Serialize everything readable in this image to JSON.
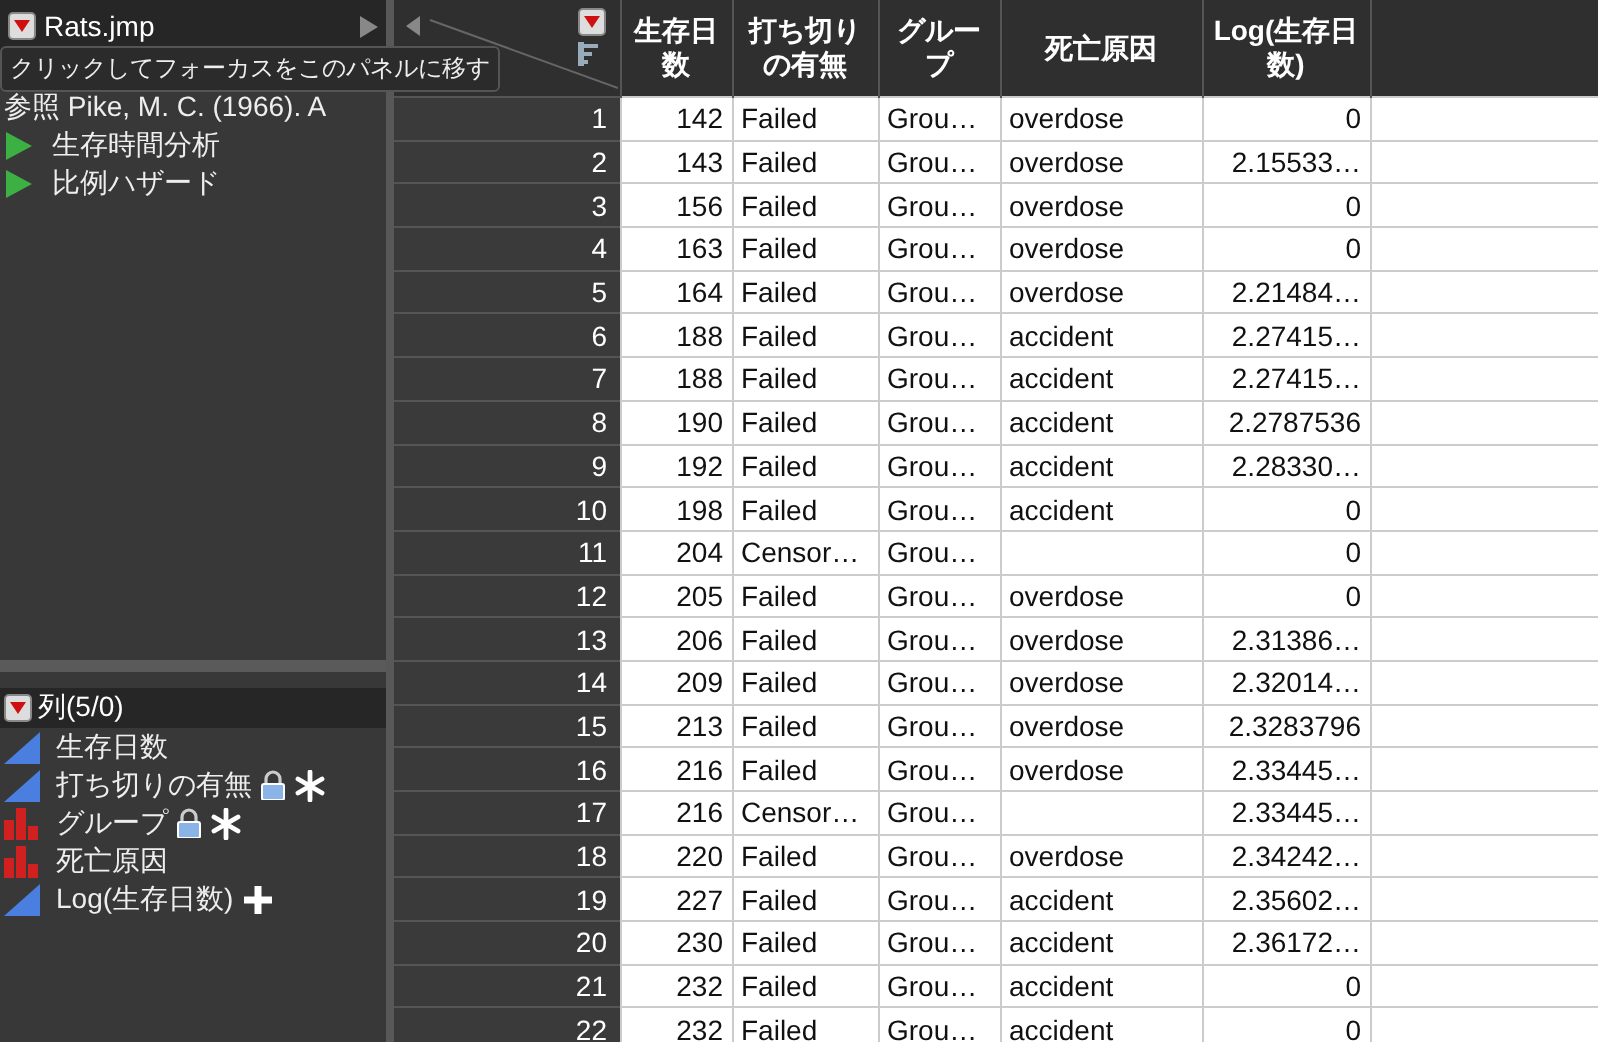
{
  "table_panel": {
    "title": "Rats.jmp",
    "tooltip": "クリックしてフォーカスをこのパネルに移す",
    "notes": "参照  Pike, M. C. (1966). A",
    "scripts": [
      {
        "label": "生存時間分析"
      },
      {
        "label": "比例ハザード"
      }
    ]
  },
  "columns_panel": {
    "title": "列(5/0)",
    "columns": [
      {
        "name": "生存日数",
        "kind": "continuous",
        "locked": false,
        "has_property": false,
        "has_formula": false
      },
      {
        "name": "打ち切りの有無",
        "kind": "continuous",
        "locked": true,
        "has_property": true,
        "has_formula": false
      },
      {
        "name": "グループ",
        "kind": "nominal",
        "locked": true,
        "has_property": true,
        "has_formula": false
      },
      {
        "name": "死亡原因",
        "kind": "nominal",
        "locked": false,
        "has_property": false,
        "has_formula": false
      },
      {
        "name": "Log(生存日数)",
        "kind": "continuous",
        "locked": false,
        "has_property": false,
        "has_formula": true
      }
    ]
  },
  "table": {
    "columns": [
      "生存日数",
      "打ち切りの有無",
      "グループ",
      "死亡原因",
      "Log(生存日数)"
    ],
    "rows": [
      {
        "n": "1",
        "cells": [
          "142",
          "Failed",
          "Grou…",
          "overdose",
          "0"
        ]
      },
      {
        "n": "2",
        "cells": [
          "143",
          "Failed",
          "Grou…",
          "overdose",
          "2.15533…"
        ]
      },
      {
        "n": "3",
        "cells": [
          "156",
          "Failed",
          "Grou…",
          "overdose",
          "0"
        ]
      },
      {
        "n": "4",
        "cells": [
          "163",
          "Failed",
          "Grou…",
          "overdose",
          "0"
        ]
      },
      {
        "n": "5",
        "cells": [
          "164",
          "Failed",
          "Grou…",
          "overdose",
          "2.21484…"
        ]
      },
      {
        "n": "6",
        "cells": [
          "188",
          "Failed",
          "Grou…",
          "accident",
          "2.27415…"
        ]
      },
      {
        "n": "7",
        "cells": [
          "188",
          "Failed",
          "Grou…",
          "accident",
          "2.27415…"
        ]
      },
      {
        "n": "8",
        "cells": [
          "190",
          "Failed",
          "Grou…",
          "accident",
          "2.2787536"
        ]
      },
      {
        "n": "9",
        "cells": [
          "192",
          "Failed",
          "Grou…",
          "accident",
          "2.28330…"
        ]
      },
      {
        "n": "10",
        "cells": [
          "198",
          "Failed",
          "Grou…",
          "accident",
          "0"
        ]
      },
      {
        "n": "11",
        "cells": [
          "204",
          "Censor…",
          "Grou…",
          null,
          "0"
        ]
      },
      {
        "n": "12",
        "cells": [
          "205",
          "Failed",
          "Grou…",
          "overdose",
          "0"
        ]
      },
      {
        "n": "13",
        "cells": [
          "206",
          "Failed",
          "Grou…",
          "overdose",
          "2.31386…"
        ]
      },
      {
        "n": "14",
        "cells": [
          "209",
          "Failed",
          "Grou…",
          "overdose",
          "2.32014…"
        ]
      },
      {
        "n": "15",
        "cells": [
          "213",
          "Failed",
          "Grou…",
          "overdose",
          "2.3283796"
        ]
      },
      {
        "n": "16",
        "cells": [
          "216",
          "Failed",
          "Grou…",
          "overdose",
          "2.33445…"
        ]
      },
      {
        "n": "17",
        "cells": [
          "216",
          "Censor…",
          "Grou…",
          null,
          "2.33445…"
        ]
      },
      {
        "n": "18",
        "cells": [
          "220",
          "Failed",
          "Grou…",
          "overdose",
          "2.34242…"
        ]
      },
      {
        "n": "19",
        "cells": [
          "227",
          "Failed",
          "Grou…",
          "accident",
          "2.35602…"
        ]
      },
      {
        "n": "20",
        "cells": [
          "230",
          "Failed",
          "Grou…",
          "accident",
          "2.36172…"
        ]
      },
      {
        "n": "21",
        "cells": [
          "232",
          "Failed",
          "Grou…",
          "accident",
          "0"
        ]
      },
      {
        "n": "22",
        "cells": [
          "232",
          "Failed",
          "Grou…",
          "accident",
          "0"
        ]
      }
    ]
  }
}
